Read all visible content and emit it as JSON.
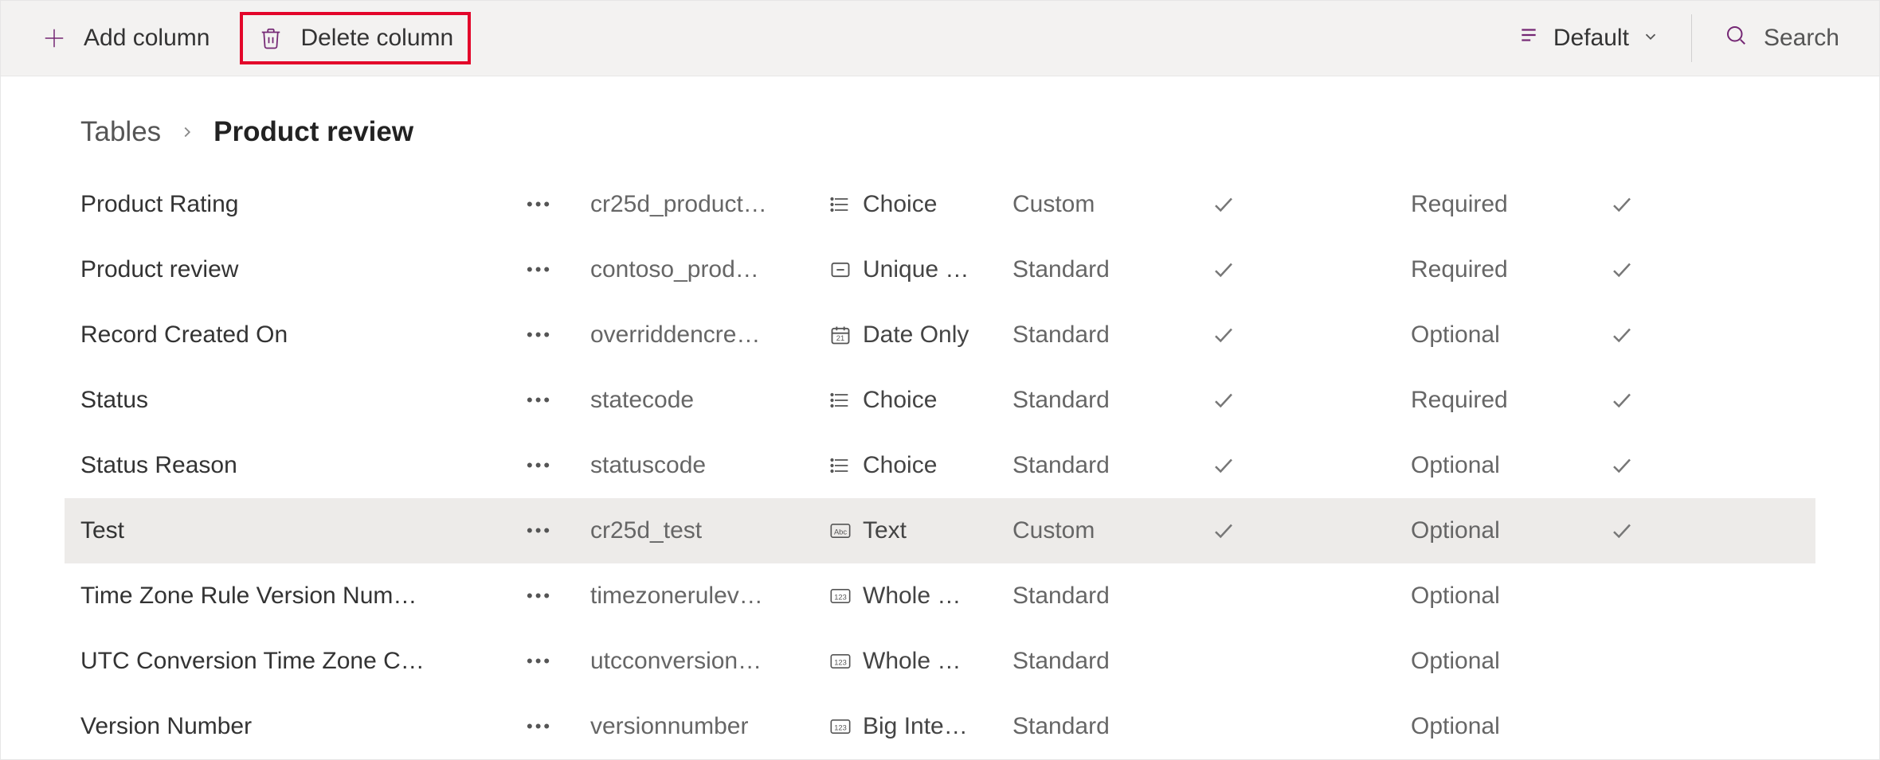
{
  "toolbar": {
    "add_label": "Add column",
    "delete_label": "Delete column",
    "view_label": "Default",
    "search_label": "Search"
  },
  "breadcrumb": {
    "root": "Tables",
    "current": "Product review"
  },
  "columns": [
    {
      "display": "Product Rating",
      "name": "cr25d_product…",
      "type": "Choice",
      "typeicon": "choice",
      "kind": "Custom",
      "check1": true,
      "required": "Required",
      "check2": true,
      "selected": false
    },
    {
      "display": "Product review",
      "name": "contoso_prod…",
      "type": "Unique …",
      "typeicon": "unique",
      "kind": "Standard",
      "check1": true,
      "required": "Required",
      "check2": true,
      "selected": false
    },
    {
      "display": "Record Created On",
      "name": "overriddencre…",
      "type": "Date Only",
      "typeicon": "date",
      "kind": "Standard",
      "check1": true,
      "required": "Optional",
      "check2": true,
      "selected": false
    },
    {
      "display": "Status",
      "name": "statecode",
      "type": "Choice",
      "typeicon": "choice",
      "kind": "Standard",
      "check1": true,
      "required": "Required",
      "check2": true,
      "selected": false
    },
    {
      "display": "Status Reason",
      "name": "statuscode",
      "type": "Choice",
      "typeicon": "choice",
      "kind": "Standard",
      "check1": true,
      "required": "Optional",
      "check2": true,
      "selected": false
    },
    {
      "display": "Test",
      "name": "cr25d_test",
      "type": "Text",
      "typeicon": "text",
      "kind": "Custom",
      "check1": true,
      "required": "Optional",
      "check2": true,
      "selected": true
    },
    {
      "display": "Time Zone Rule Version Num…",
      "name": "timezonerulev…",
      "type": "Whole …",
      "typeicon": "number",
      "kind": "Standard",
      "check1": false,
      "required": "Optional",
      "check2": false,
      "selected": false
    },
    {
      "display": "UTC Conversion Time Zone C…",
      "name": "utcconversion…",
      "type": "Whole …",
      "typeicon": "number",
      "kind": "Standard",
      "check1": false,
      "required": "Optional",
      "check2": false,
      "selected": false
    },
    {
      "display": "Version Number",
      "name": "versionnumber",
      "type": "Big Inte…",
      "typeicon": "number",
      "kind": "Standard",
      "check1": false,
      "required": "Optional",
      "check2": false,
      "selected": false
    }
  ]
}
